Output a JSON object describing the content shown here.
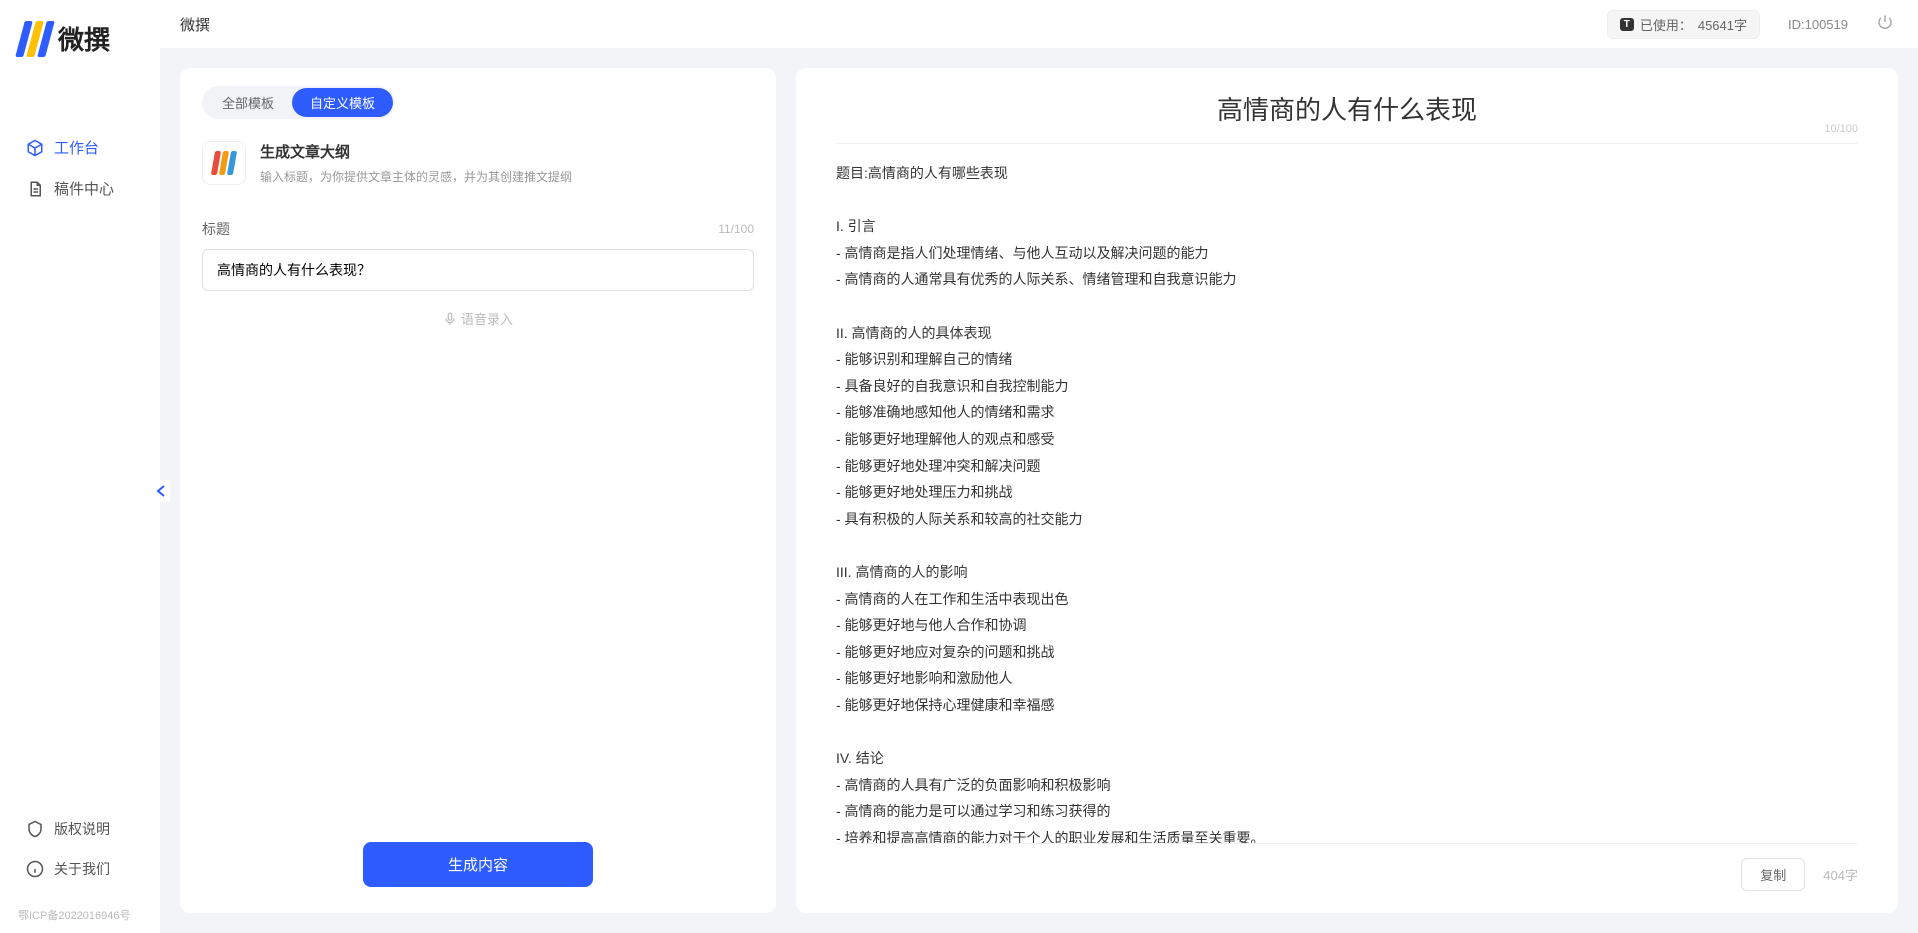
{
  "app": {
    "logoText": "微撰",
    "headerTitle": "微撰",
    "usageLabel": "已使用：",
    "usageValue": "45641字",
    "idLabel": "ID:100519"
  },
  "sidebar": {
    "items": [
      {
        "label": "工作台"
      },
      {
        "label": "稿件中心"
      }
    ],
    "bottomItems": [
      {
        "label": "版权说明"
      },
      {
        "label": "关于我们"
      }
    ],
    "icp": "鄂ICP备2022016946号"
  },
  "leftPanel": {
    "tabs": [
      {
        "label": "全部模板"
      },
      {
        "label": "自定义模板"
      }
    ],
    "template": {
      "title": "生成文章大纲",
      "desc": "输入标题，为你提供文章主体的灵感，并为其创建推文提纲"
    },
    "titleField": {
      "label": "标题",
      "counter": "11/100",
      "value": "高情商的人有什么表现？"
    },
    "voiceLabel": "语音录入",
    "generateLabel": "生成内容"
  },
  "output": {
    "title": "高情商的人有什么表现",
    "titleCounter": "10/100",
    "body": "题目:高情商的人有哪些表现\n\nI. 引言\n- 高情商是指人们处理情绪、与他人互动以及解决问题的能力\n- 高情商的人通常具有优秀的人际关系、情绪管理和自我意识能力\n\nII. 高情商的人的具体表现\n- 能够识别和理解自己的情绪\n- 具备良好的自我意识和自我控制能力\n- 能够准确地感知他人的情绪和需求\n- 能够更好地理解他人的观点和感受\n- 能够更好地处理冲突和解决问题\n- 能够更好地处理压力和挑战\n- 具有积极的人际关系和较高的社交能力\n\nIII. 高情商的人的影响\n- 高情商的人在工作和生活中表现出色\n- 能够更好地与他人合作和协调\n- 能够更好地应对复杂的问题和挑战\n- 能够更好地影响和激励他人\n- 能够更好地保持心理健康和幸福感\n\nIV. 结论\n- 高情商的人具有广泛的负面影响和积极影响\n- 高情商的能力是可以通过学习和练习获得的\n- 培养和提高高情商的能力对于个人的职业发展和生活质量至关重要。",
    "copyLabel": "复制",
    "charCount": "404字"
  }
}
